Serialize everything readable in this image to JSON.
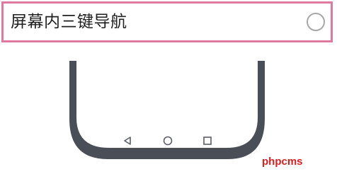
{
  "option": {
    "label": "屏幕内三键导航",
    "selected": false,
    "border_color": "#e0799e",
    "radio_color": "#a7a7a7"
  },
  "nav_buttons": [
    {
      "icon": "back-triangle-icon"
    },
    {
      "icon": "home-circle-icon"
    },
    {
      "icon": "recents-square-icon"
    }
  ],
  "phone": {
    "frame_color": "#4a4f57",
    "icon_color": "#5a5f66"
  },
  "watermark": {
    "text": "phpcms",
    "color": "#d81e1e"
  }
}
